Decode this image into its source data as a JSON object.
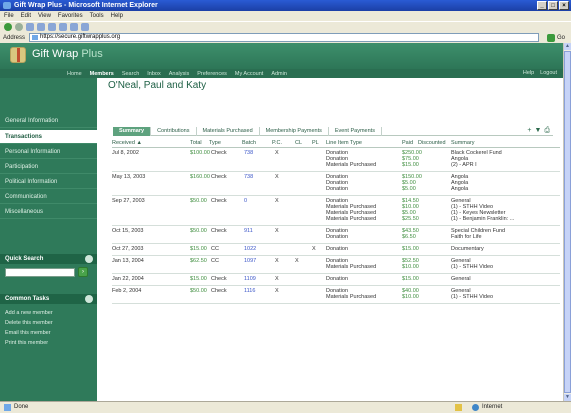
{
  "browser": {
    "title": "Gift Wrap Plus - Microsoft Internet Explorer",
    "menu": [
      "File",
      "Edit",
      "View",
      "Favorites",
      "Tools",
      "Help"
    ],
    "address_label": "Address",
    "address": "https://secure.giftwrapplus.org",
    "go_label": "Go",
    "status_left": "Done",
    "status_right": "Internet"
  },
  "app": {
    "title": "Gift Wrap",
    "title_plus": "Plus",
    "nav": [
      "Home",
      "Members",
      "Search",
      "Inbox",
      "Analysis",
      "Preferences",
      "My Account",
      "Admin"
    ],
    "nav_active": "Members",
    "nav_right": [
      "Help",
      "Logout"
    ]
  },
  "sidebar": {
    "items": [
      "General Information",
      "Transactions",
      "Personal Information",
      "Participation",
      "Political Information",
      "Communication",
      "Miscellaneous"
    ],
    "active": "Transactions",
    "quick_search_title": "Quick Search",
    "common_tasks_title": "Common Tasks",
    "tasks": [
      "Add a new member",
      "Delete this member",
      "Email this member",
      "Print this member"
    ]
  },
  "main": {
    "person_name": "O'Neal, Paul and Katy",
    "tabs": [
      "Summary",
      "Contributions",
      "Materials Purchased",
      "Membership Payments",
      "Event Payments"
    ],
    "active_tab": "Summary",
    "tools": [
      "+",
      "▼",
      "⎙"
    ],
    "columns": [
      "Received ▲",
      "Total",
      "Type",
      "Batch",
      "P.C.",
      "CL",
      "PL",
      "Line Item Type",
      "Paid",
      "Discounted",
      "Summary"
    ]
  },
  "transactions": [
    {
      "date": "Jul 8, 2002",
      "total": "$100.00",
      "type": "Check",
      "batch": "738",
      "pc": "X",
      "cl": "",
      "pl": "",
      "lines": [
        {
          "item": "Donation",
          "paid": "$250.00",
          "summary": "Black Cockerel Fund"
        },
        {
          "item": "Donation",
          "paid": "$75.00",
          "summary": "Angola"
        },
        {
          "item": "Materials Purchased",
          "paid": "$15.00",
          "summary": "(2) - APR I"
        }
      ]
    },
    {
      "date": "May 13, 2003",
      "total": "$160.00",
      "type": "Check",
      "batch": "738",
      "pc": "X",
      "cl": "",
      "pl": "",
      "lines": [
        {
          "item": "Donation",
          "paid": "$150.00",
          "summary": "Angola"
        },
        {
          "item": "Donation",
          "paid": "$5.00",
          "summary": "Angola"
        },
        {
          "item": "Donation",
          "paid": "$5.00",
          "summary": "Angola"
        }
      ]
    },
    {
      "date": "Sep 27, 2003",
      "total": "$50.00",
      "type": "Check",
      "batch": "0",
      "pc": "X",
      "cl": "",
      "pl": "",
      "lines": [
        {
          "item": "Donation",
          "paid": "$14.50",
          "summary": "General"
        },
        {
          "item": "Materials Purchased",
          "paid": "$10.00",
          "summary": "(1) - STHH Video"
        },
        {
          "item": "Materials Purchased",
          "paid": "$5.00",
          "summary": "(1) - Keyes Newsletter"
        },
        {
          "item": "Materials Purchased",
          "paid": "$25.50",
          "summary": "(1) - Benjamin Franklin: ..."
        }
      ]
    },
    {
      "date": "Oct 15, 2003",
      "total": "$50.00",
      "type": "Check",
      "batch": "911",
      "pc": "X",
      "cl": "",
      "pl": "",
      "lines": [
        {
          "item": "Donation",
          "paid": "$43.50",
          "summary": "Special Children Fund"
        },
        {
          "item": "Donation",
          "paid": "$6.50",
          "summary": "Faith for Life"
        }
      ]
    },
    {
      "date": "Oct 27, 2003",
      "total": "$15.00",
      "type": "CC",
      "batch": "1022",
      "pc": "",
      "cl": "",
      "pl": "X",
      "lines": [
        {
          "item": "Donation",
          "paid": "$15.00",
          "summary": "Documentary"
        }
      ]
    },
    {
      "date": "Jan 13, 2004",
      "total": "$62.50",
      "type": "CC",
      "batch": "1097",
      "pc": "X",
      "cl": "X",
      "pl": "",
      "lines": [
        {
          "item": "Donation",
          "paid": "$52.50",
          "summary": "General"
        },
        {
          "item": "Materials Purchased",
          "paid": "$10.00",
          "summary": "(1) - STHH Video"
        }
      ]
    },
    {
      "date": "Jan 22, 2004",
      "total": "$15.00",
      "type": "Check",
      "batch": "1109",
      "pc": "X",
      "cl": "",
      "pl": "",
      "lines": [
        {
          "item": "Donation",
          "paid": "$15.00",
          "summary": "General"
        }
      ]
    },
    {
      "date": "Feb 2, 2004",
      "total": "$50.00",
      "type": "Check",
      "batch": "1116",
      "pc": "X",
      "cl": "",
      "pl": "",
      "lines": [
        {
          "item": "Donation",
          "paid": "$40.00",
          "summary": "General"
        },
        {
          "item": "Materials Purchased",
          "paid": "$10.00",
          "summary": "(1) - STHH Video"
        }
      ]
    }
  ]
}
